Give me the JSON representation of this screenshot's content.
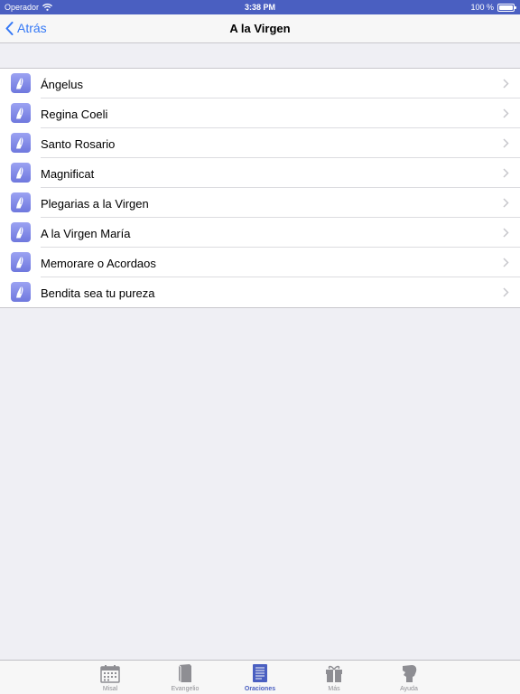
{
  "status": {
    "carrier": "Operador",
    "time": "3:38 PM",
    "battery": "100 %"
  },
  "nav": {
    "back_label": "Atrás",
    "title": "A la Virgen"
  },
  "items": [
    {
      "label": "Ángelus"
    },
    {
      "label": "Regina Coeli"
    },
    {
      "label": "Santo Rosario"
    },
    {
      "label": "Magnificat"
    },
    {
      "label": "Plegarias a la Virgen"
    },
    {
      "label": "A la Virgen María"
    },
    {
      "label": "Memorare o Acordaos"
    },
    {
      "label": "Bendita sea tu pureza"
    }
  ],
  "tabs": [
    {
      "label": "Misal",
      "icon": "calendar-icon"
    },
    {
      "label": "Evangelio",
      "icon": "book-icon"
    },
    {
      "label": "Oraciones",
      "icon": "document-icon",
      "active": true
    },
    {
      "label": "Más",
      "icon": "gift-icon"
    },
    {
      "label": "Ayuda",
      "icon": "help-icon"
    }
  ],
  "colors": {
    "status_bar": "#4a5fc1",
    "accent": "#3478f6",
    "tab_active": "#4a5fc1",
    "row_icon": "#7b84e4"
  }
}
